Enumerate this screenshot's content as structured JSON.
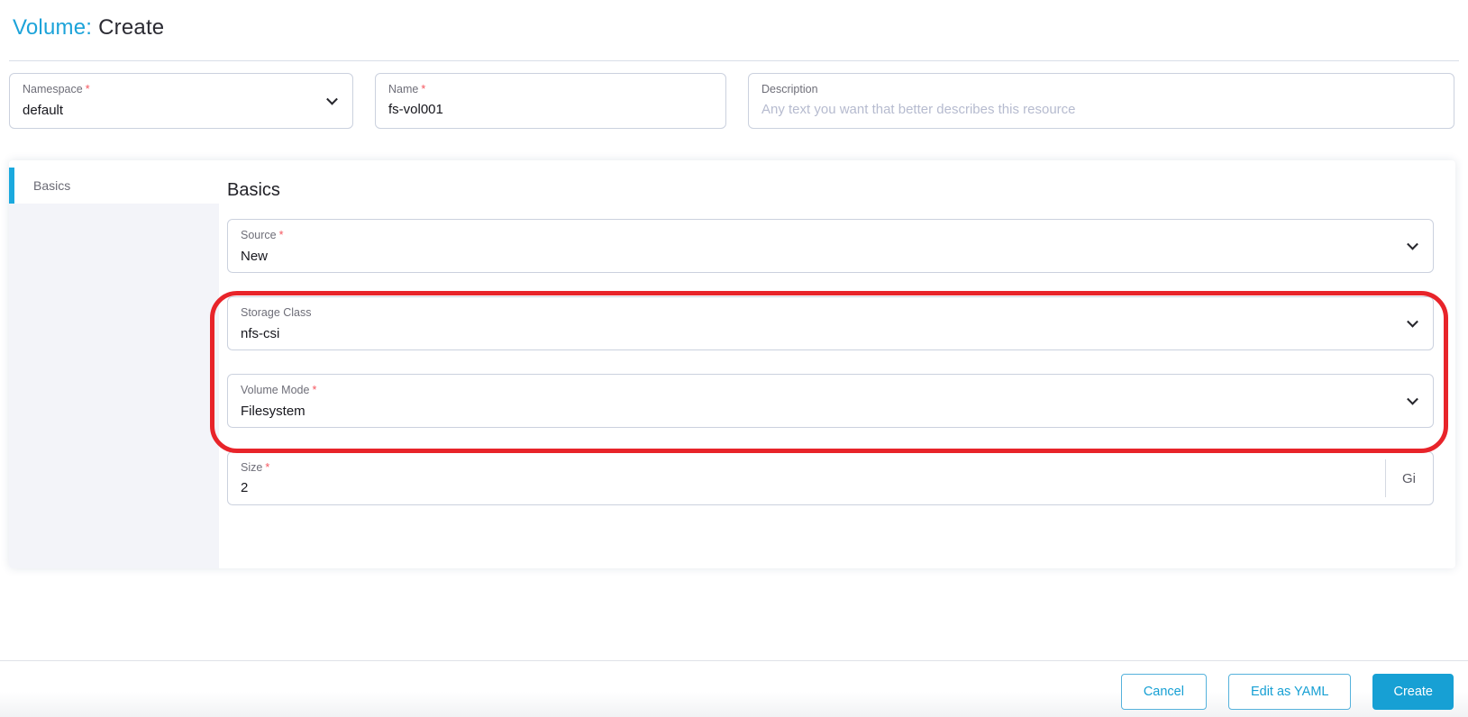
{
  "header": {
    "title_prefix": "Volume:",
    "title_suffix": "Create"
  },
  "top_form": {
    "namespace": {
      "label": "Namespace",
      "required_marker": "*",
      "value": "default"
    },
    "name": {
      "label": "Name",
      "required_marker": "*",
      "value": "fs-vol001"
    },
    "description": {
      "label": "Description",
      "placeholder": "Any text you want that better describes this resource"
    }
  },
  "sidebar": {
    "tabs": [
      {
        "label": "Basics",
        "active": true
      }
    ]
  },
  "section": {
    "heading": "Basics",
    "fields": [
      {
        "label": "Source",
        "required_marker": "*",
        "value": "New",
        "type": "select"
      },
      {
        "label": "Storage Class",
        "required_marker": "",
        "value": "nfs-csi",
        "type": "select",
        "annotated": true
      },
      {
        "label": "Volume Mode",
        "required_marker": "*",
        "value": "Filesystem",
        "type": "select",
        "annotated": true
      },
      {
        "label": "Size",
        "required_marker": "*",
        "value": "2",
        "type": "text",
        "suffix": "Gi"
      }
    ]
  },
  "annotation": {
    "shape": "red-oval",
    "encloses": [
      "Storage Class",
      "Volume Mode"
    ]
  },
  "footer": {
    "buttons": [
      {
        "label": "Cancel",
        "style": "outline"
      },
      {
        "label": "Edit as YAML",
        "style": "outline"
      },
      {
        "label": "Create",
        "style": "primary"
      }
    ]
  },
  "colors": {
    "primary": "#17A0D4",
    "tab_indicator": "#1BA9DE",
    "annotation_red": "#E8242A",
    "required_red": "#F5575F",
    "sidebar_bg": "#F3F4F9"
  }
}
